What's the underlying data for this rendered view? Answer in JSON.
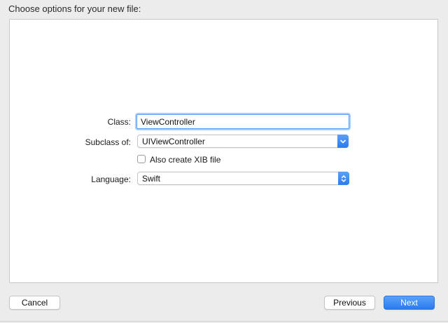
{
  "header": {
    "title": "Choose options for your new file:"
  },
  "form": {
    "class_label": "Class:",
    "class_value": "ViewController",
    "subclass_label": "Subclass of:",
    "subclass_value": "UIViewController",
    "xib_checkbox_label": "Also create XIB file",
    "xib_checked": false,
    "language_label": "Language:",
    "language_value": "Swift"
  },
  "footer": {
    "cancel_label": "Cancel",
    "previous_label": "Previous",
    "next_label": "Next"
  },
  "colors": {
    "accent": "#2a7bf0",
    "focus_ring": "#a9cdf9",
    "background": "#ececec",
    "panel": "#ffffff"
  },
  "icons": {
    "subclass_popup": "chevron-down-icon",
    "language_popup": "up-down-chevron-icon"
  }
}
